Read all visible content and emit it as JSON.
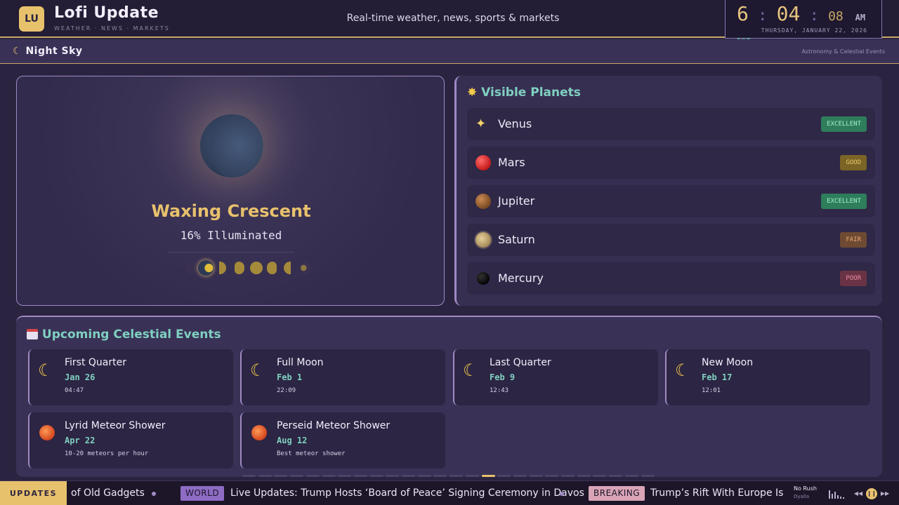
{
  "app": {
    "logo": "LU",
    "title": "Lofi Update",
    "subtitle": "WEATHER · NEWS · MARKETS",
    "tagline": "Real-time weather, news, sports & markets"
  },
  "clock": {
    "hour": "6",
    "minute": "04",
    "second": "08",
    "ampm": "AM",
    "timezone": "EST",
    "date": "THURSDAY, JANUARY 22, 2026"
  },
  "section": {
    "icon": "crescent-moon-icon",
    "title": "Night Sky",
    "right_label": "Astronomy & Celestial Events"
  },
  "moon": {
    "phase_name": "Waxing Crescent",
    "illumination_text": "16% Illuminated",
    "illumination_fraction": 0.16
  },
  "planets": {
    "heading": "Visible Planets",
    "heading_icon": "glowing-star-icon",
    "items": [
      {
        "name": "Venus",
        "icon": "sparkles-icon",
        "visibility": "EXCELLENT",
        "color": "#2e7d5b",
        "text_color": "#a6f0c8"
      },
      {
        "name": "Mars",
        "icon": "red-planet-icon",
        "visibility": "GOOD",
        "color": "#7a6426",
        "text_color": "#e8c86a"
      },
      {
        "name": "Jupiter",
        "icon": "brown-planet-icon",
        "visibility": "EXCELLENT",
        "color": "#2e7d5b",
        "text_color": "#a6f0c8"
      },
      {
        "name": "Saturn",
        "icon": "ringed-planet-icon",
        "visibility": "FAIR",
        "color": "#6e4a32",
        "text_color": "#e8a878"
      },
      {
        "name": "Mercury",
        "icon": "dark-planet-icon",
        "visibility": "POOR",
        "color": "#6a3345",
        "text_color": "#e88aa0"
      }
    ]
  },
  "events": {
    "heading": "Upcoming Celestial Events",
    "heading_icon": "calendar-icon",
    "items": [
      {
        "name": "First Quarter",
        "date": "Jan 26",
        "detail": "04:47",
        "icon": "crescent-moon-icon"
      },
      {
        "name": "Full Moon",
        "date": "Feb 1",
        "detail": "22:09",
        "icon": "crescent-moon-icon"
      },
      {
        "name": "Last Quarter",
        "date": "Feb 9",
        "detail": "12:43",
        "icon": "crescent-moon-icon"
      },
      {
        "name": "New Moon",
        "date": "Feb 17",
        "detail": "12:01",
        "icon": "crescent-moon-icon"
      },
      {
        "name": "Lyrid Meteor Shower",
        "date": "Apr 22",
        "detail": "10-20 meteors per hour",
        "icon": "comet-icon"
      },
      {
        "name": "Perseid Meteor Shower",
        "date": "Aug 12",
        "detail": "Best meteor shower",
        "icon": "comet-icon"
      }
    ]
  },
  "pagination": {
    "total": 26,
    "active": 15
  },
  "ticker": {
    "label": "UPDATES",
    "item_1_text": "of Old Gadgets",
    "tag_1": "WORLD",
    "item_2_text": "Live Updates: Trump Hosts ‘Board of Peace’ Signing Ceremony in Davos",
    "tag_2": "BREAKING",
    "item_3_text": "Trump’s Rift With Europe Is Cl",
    "colors": {
      "world": "#8e6cc4",
      "breaking": "#d9a4b8"
    }
  },
  "player": {
    "track": "No Rush",
    "artist": "Dyalla",
    "prev_icon": "previous-icon",
    "pause_icon": "pause-icon"
  }
}
